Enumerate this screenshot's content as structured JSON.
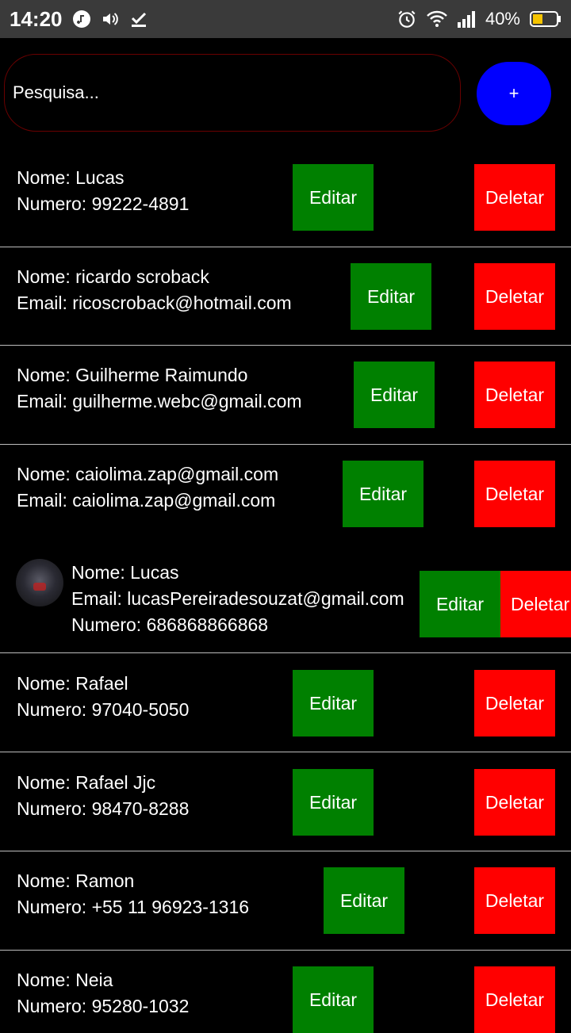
{
  "status_bar": {
    "time": "14:20",
    "battery": "40%"
  },
  "search": {
    "placeholder": "Pesquisa..."
  },
  "add_button": {
    "label": "+"
  },
  "buttons": {
    "edit": "Editar",
    "delete": "Deletar"
  },
  "contacts": [
    {
      "line1": "Nome: Lucas",
      "line2": "Numero: 99222-4891"
    },
    {
      "line1": "Nome: ricardo scroback",
      "line2": "Email: ricoscroback@hotmail.com"
    },
    {
      "line1": "Nome: Guilherme Raimundo",
      "line2": "Email: guilherme.webc@gmail.com"
    },
    {
      "line1": "Nome: caiolima.zap@gmail.com",
      "line2": "Email: caiolima.zap@gmail.com"
    },
    {
      "line1": "Nome: Lucas",
      "line2": "Email: lucasPereiradesouzat@gmail.com",
      "line3": "Numero: 686868866868"
    },
    {
      "line1": "Nome: Rafael",
      "line2": "Numero: 97040-5050"
    },
    {
      "line1": "Nome: Rafael Jjc",
      "line2": "Numero: 98470-8288"
    },
    {
      "line1": "Nome: Ramon",
      "line2": "Numero: +55 11 96923-1316"
    },
    {
      "line1": "Nome: Neia",
      "line2": "Numero: 95280-1032"
    }
  ],
  "colors": {
    "edit": "#008000",
    "delete": "#ff0000",
    "add": "#0000ff",
    "search_border": "#6a0000"
  }
}
